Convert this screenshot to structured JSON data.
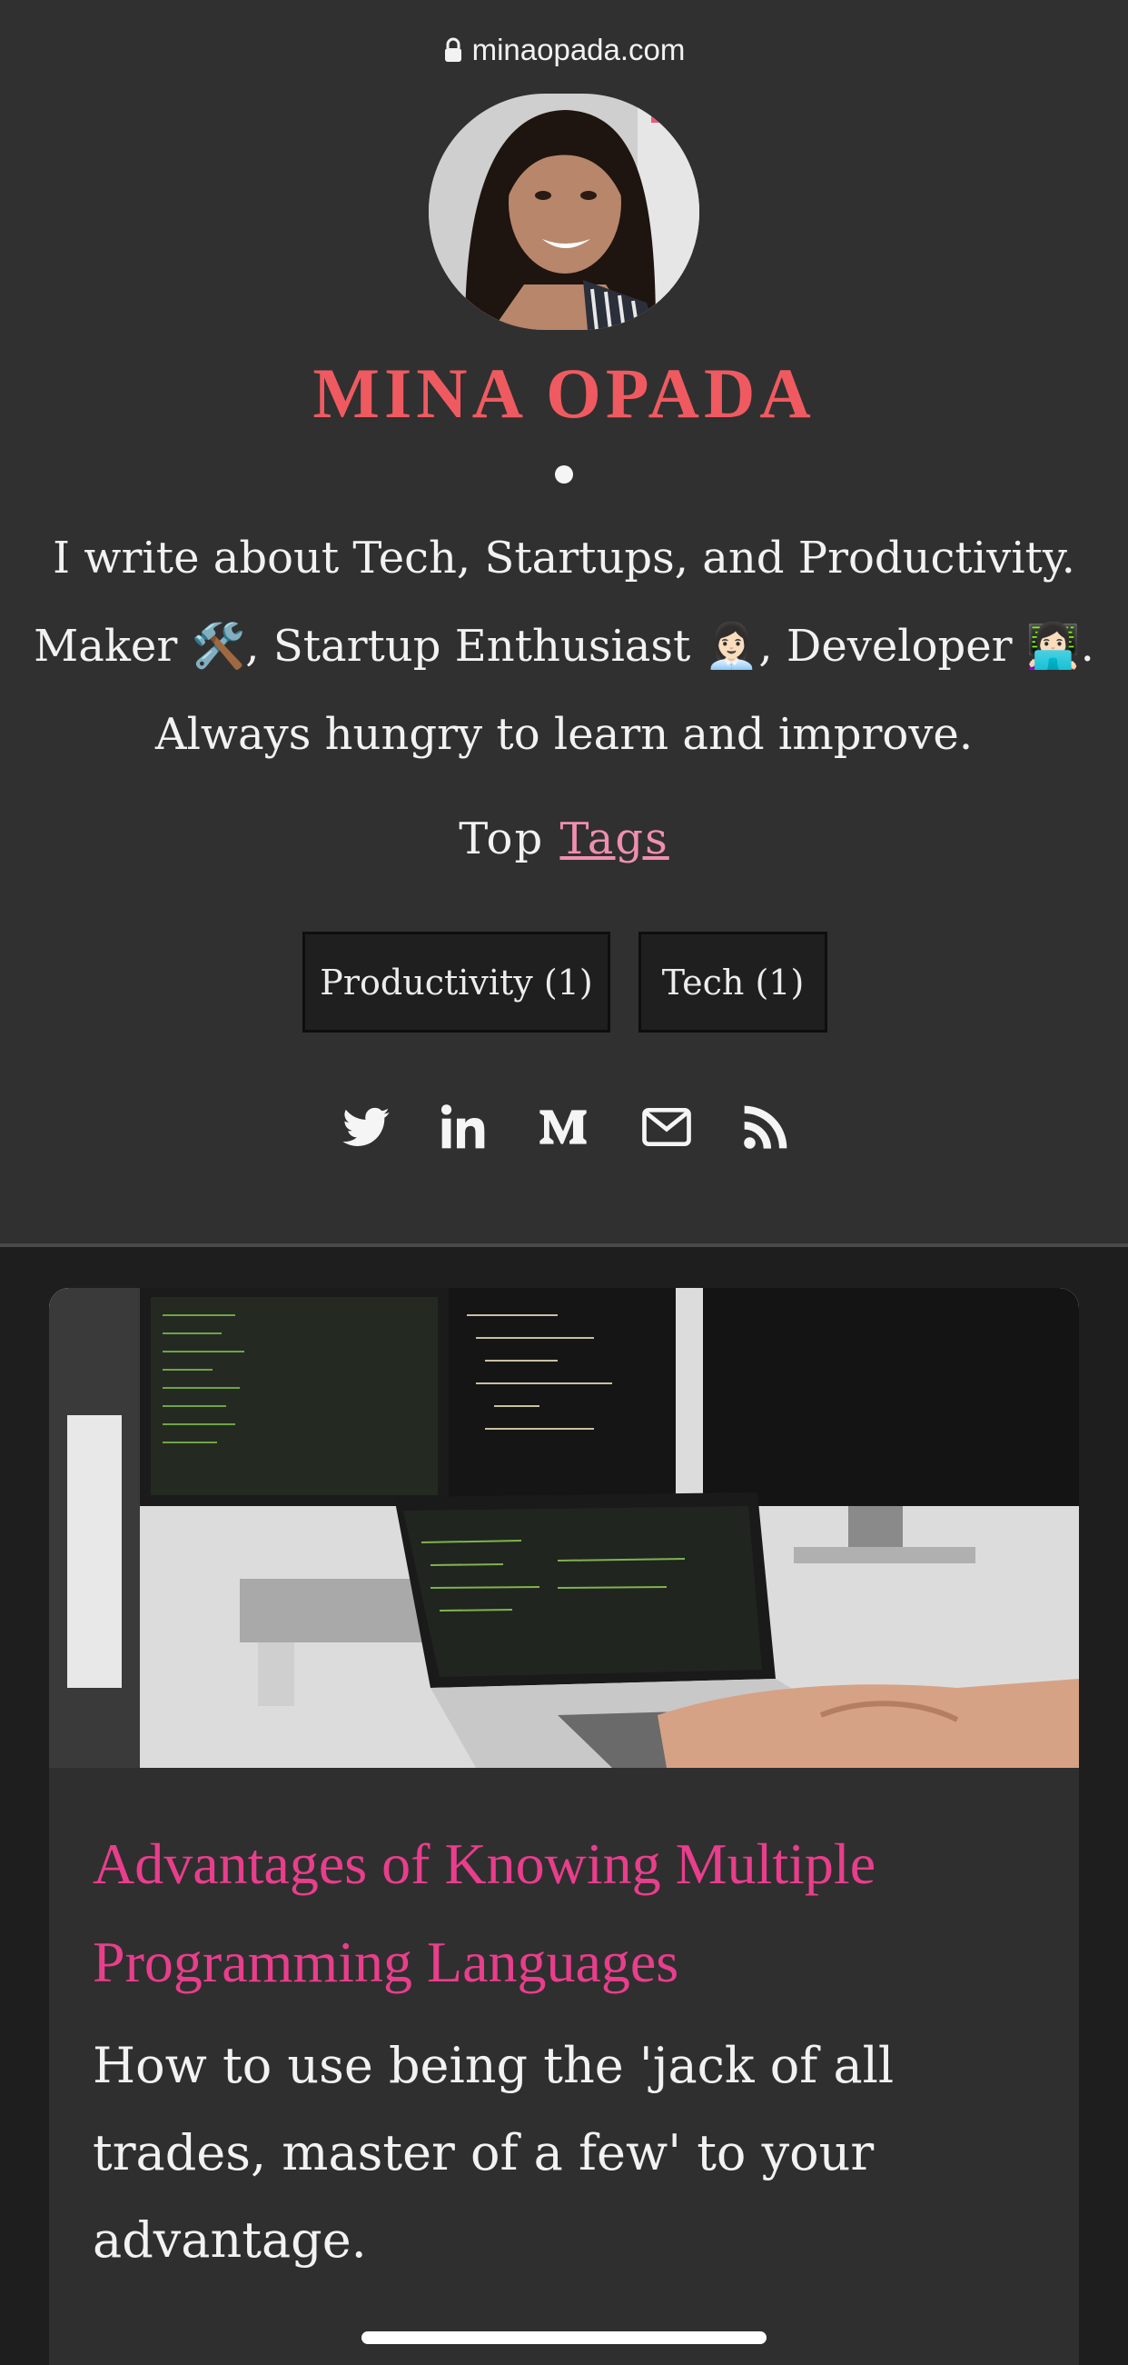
{
  "browser": {
    "url": "minaopada.com",
    "lock_icon": "lock-icon"
  },
  "profile": {
    "name": "MINA OPADA",
    "bio_lines": [
      "I write about Tech, Startups, and Productivity.",
      "Maker 🛠️, Startup Enthusiast 👩🏻‍💼, Developer 👩🏻‍💻.",
      "Always hungry to learn and improve."
    ],
    "top_tags_prefix": "Top",
    "top_tags_link": "Tags",
    "tags": [
      {
        "label": "Productivity (1)"
      },
      {
        "label": "Tech (1)"
      }
    ],
    "social_icons": [
      "twitter-icon",
      "linkedin-icon",
      "medium-icon",
      "email-icon",
      "rss-icon"
    ]
  },
  "post": {
    "title_lines": [
      "Advantages of Knowing Multiple",
      "Programming Languages"
    ],
    "excerpt_lines": [
      "How to use being the 'jack of all",
      "trades, master of a few' to your",
      "advantage."
    ]
  },
  "colors": {
    "accent_name": "#ef5a60",
    "accent_title": "#e83e8c",
    "tag_link": "#ef8fb0",
    "background": "#303030"
  }
}
